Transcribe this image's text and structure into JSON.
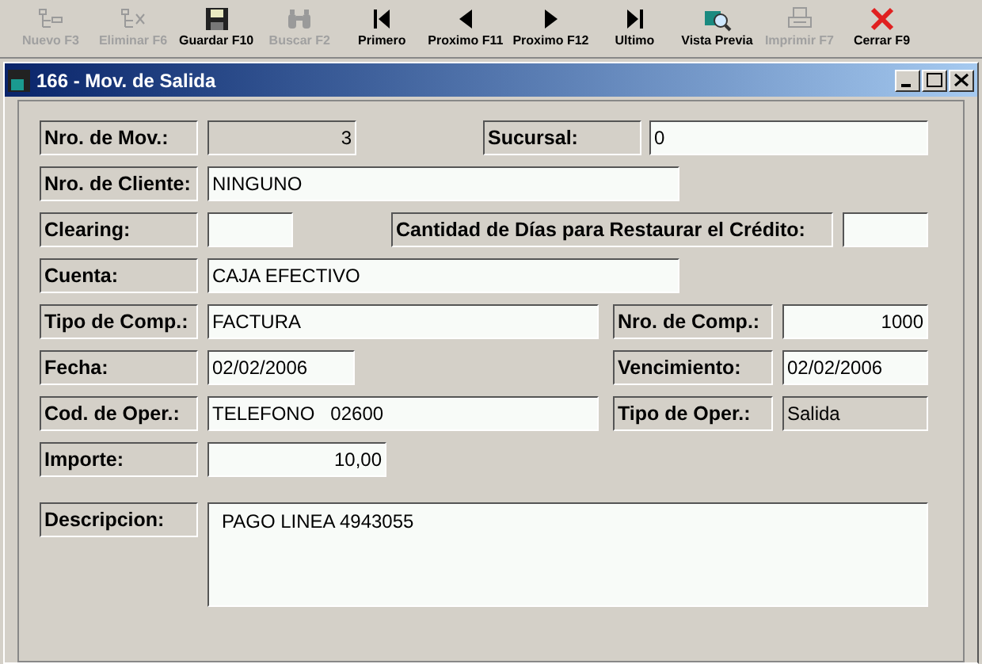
{
  "toolbar": [
    {
      "label": "Nuevo F3",
      "disabled": true
    },
    {
      "label": "Eliminar F6",
      "disabled": true
    },
    {
      "label": "Guardar F10",
      "disabled": false
    },
    {
      "label": "Buscar F2",
      "disabled": true
    },
    {
      "label": "Primero",
      "disabled": false
    },
    {
      "label": "Proximo F11",
      "disabled": false
    },
    {
      "label": "Proximo F12",
      "disabled": false
    },
    {
      "label": "Ultimo",
      "disabled": false
    },
    {
      "label": "Vista Previa",
      "disabled": false
    },
    {
      "label": "Imprimir F7",
      "disabled": true
    },
    {
      "label": "Cerrar F9",
      "disabled": false
    }
  ],
  "window": {
    "title": "166 - Mov. de Salida"
  },
  "form": [
    [
      {
        "kind": "label",
        "text": "Nro. de Mov.:"
      },
      {
        "kind": "field",
        "value": "3",
        "readonly": true
      },
      {
        "kind": "label",
        "text": "Sucursal:"
      },
      {
        "kind": "field",
        "value": "0",
        "readonly": false
      }
    ],
    [
      {
        "kind": "label",
        "text": "Nro. de Cliente:"
      },
      {
        "kind": "field",
        "value": "NINGUNO",
        "readonly": false
      }
    ],
    [
      {
        "kind": "label",
        "text": "Clearing:"
      },
      {
        "kind": "field",
        "readonly": false
      },
      {
        "kind": "label",
        "text": "Cantidad de Días para Restaurar el Crédito:"
      },
      {
        "kind": "field",
        "readonly": false
      }
    ],
    [
      {
        "kind": "label",
        "text": "Cuenta:"
      },
      {
        "kind": "field",
        "value": "CAJA EFECTIVO",
        "readonly": false
      }
    ],
    [
      {
        "kind": "label",
        "text": "Tipo de Comp.:"
      },
      {
        "kind": "field",
        "value": "FACTURA",
        "readonly": false
      },
      {
        "kind": "label",
        "text": "Nro. de Comp.:"
      },
      {
        "kind": "field",
        "value": "1000",
        "readonly": false
      }
    ],
    [
      {
        "kind": "label",
        "text": "Fecha:"
      },
      {
        "kind": "field",
        "value": "02/02/2006",
        "readonly": false
      },
      {
        "kind": "label",
        "text": "Vencimiento:"
      },
      {
        "kind": "field",
        "value": "02/02/2006",
        "readonly": false
      }
    ],
    [
      {
        "kind": "label",
        "text": "Cod. de Oper.:"
      },
      {
        "kind": "field",
        "value": "TELEFONO   02600",
        "readonly": false
      },
      {
        "kind": "label",
        "text": "Tipo de Oper.:"
      },
      {
        "kind": "field",
        "value": "Salida",
        "readonly": true
      }
    ],
    [
      {
        "kind": "label",
        "text": "Importe:"
      },
      {
        "kind": "field",
        "value": "10,00",
        "readonly": false
      }
    ],
    [
      {
        "kind": "label",
        "text": "Descripcion:"
      },
      {
        "kind": "memo",
        "value": "PAGO LINEA 4943055",
        "readonly": false
      }
    ]
  ]
}
